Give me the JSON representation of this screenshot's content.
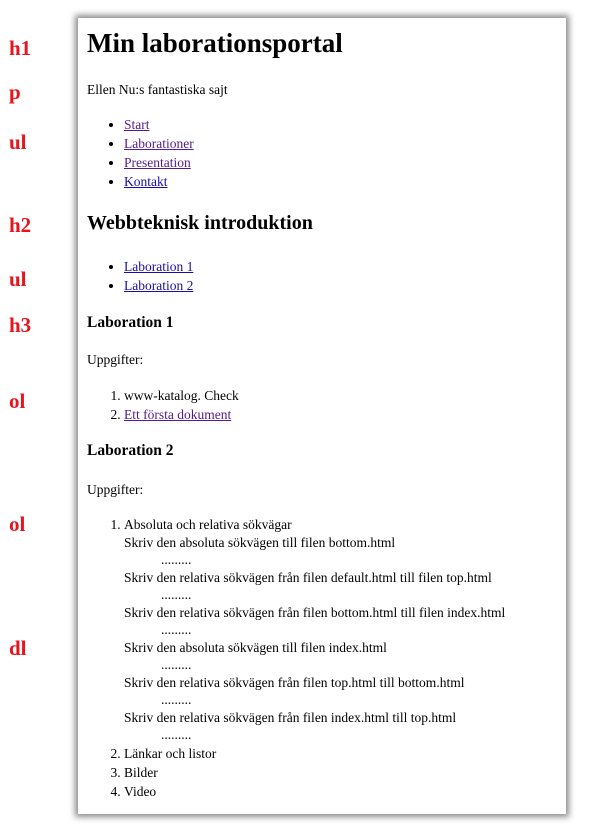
{
  "annotations": [
    "h1",
    "p",
    "ul",
    "h2",
    "ul",
    "h3",
    "ol",
    "ol",
    "dl"
  ],
  "page": {
    "h1": "Min laborationsportal",
    "tagline": "Ellen Nu:s fantastiska sajt",
    "nav": [
      "Start",
      "Laborationer",
      "Presentation",
      "Kontakt"
    ],
    "h2": "Webbteknisk introduktion",
    "lab_links": [
      "Laboration 1",
      "Laboration 2"
    ],
    "lab1": {
      "heading": "Laboration 1",
      "intro": "Uppgifter:",
      "task1": "www-katalog. Check",
      "task2_link": "Ett första dokument"
    },
    "lab2": {
      "heading": "Laboration 2",
      "intro": "Uppgifter:",
      "task1": "Absoluta och relativa sökvägar",
      "definitions": [
        {
          "term": "Skriv den absoluta sökvägen till filen bottom.html",
          "answer": "........."
        },
        {
          "term": "Skriv den relativa sökvägen från filen default.html till filen top.html",
          "answer": "........."
        },
        {
          "term": "Skriv den relativa sökvägen från filen bottom.html till filen index.html",
          "answer": "........."
        },
        {
          "term": "Skriv den absoluta sökvägen till filen index.html",
          "answer": "........."
        },
        {
          "term": "Skriv den relativa sökvägen från filen top.html till bottom.html",
          "answer": "........."
        },
        {
          "term": "Skriv den relativa sökvägen från filen index.html till top.html",
          "answer": "........."
        }
      ],
      "task2": "Länkar och listor",
      "task3": "Bilder",
      "task4": "Video"
    }
  }
}
